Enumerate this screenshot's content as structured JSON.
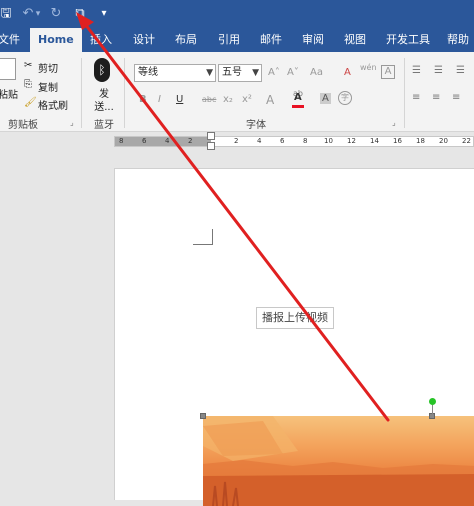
{
  "quick_access": {
    "save": "🖫",
    "undo": "↶",
    "undo_arrow": "▾",
    "redo": "↻",
    "touch": "⧉",
    "customize": "▾"
  },
  "tabs": [
    "文件",
    "Home",
    "插入",
    "设计",
    "布局",
    "引用",
    "邮件",
    "审阅",
    "视图",
    "开发工具",
    "帮助"
  ],
  "clipboard": {
    "paste": "粘贴",
    "cut": "剪切",
    "copy": "复制",
    "format_painter": "格式刷",
    "group_label": "剪贴板"
  },
  "bluetooth": {
    "send_label": "发送...",
    "group_label": "蓝牙"
  },
  "font": {
    "font_name": "等线",
    "font_size": "五号",
    "group_label": "字体",
    "grow": "A˄",
    "shrink": "A˅",
    "change_case": "Aa",
    "clear_format": "A",
    "phonetic": "wén",
    "char_border": "A",
    "bold": "B",
    "italic": "I",
    "underline": "U",
    "strike": "abc",
    "sub": "x₂",
    "sup": "x²",
    "text_effect": "A",
    "highlight": "ab",
    "font_color": "A",
    "char_shade": "A",
    "enclose": "字"
  },
  "ruler": {
    "numbers": [
      "8",
      "6",
      "4",
      "2",
      "2",
      "4",
      "6",
      "8",
      "10",
      "12",
      "14",
      "16",
      "18",
      "20",
      "22"
    ]
  },
  "document": {
    "upload_label": "播报上传视频"
  },
  "colors": {
    "brand": "#2b579a",
    "annotation": "#e02020",
    "font_color_bar": "#e81123"
  }
}
